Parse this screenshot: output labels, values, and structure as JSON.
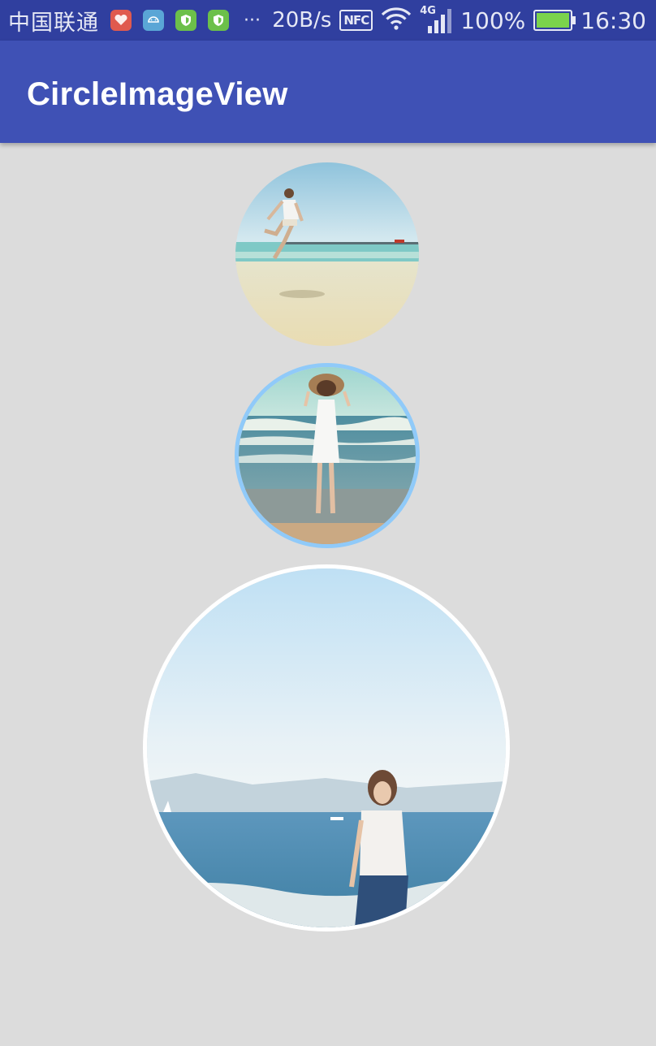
{
  "status_bar": {
    "carrier": "中国联通",
    "more_indicator": "···",
    "net_speed": "20B/s",
    "nfc_label": "NFC",
    "network_type": "4G",
    "battery_percent": "100%",
    "time": "16:30",
    "icons": [
      "health-app-icon",
      "android-app-icon",
      "shield-app-icon",
      "shield-app-icon-2",
      "wifi-icon",
      "signal-icon",
      "battery-icon"
    ]
  },
  "app_bar": {
    "title": "CircleImageView",
    "color": "#3f51b5"
  },
  "images": [
    {
      "name": "circle-image-jumping-man",
      "subject": "man jumping on beach",
      "border_color": null
    },
    {
      "name": "circle-image-woman-hat",
      "subject": "woman in white dress and straw hat facing the sea",
      "border_color": "#90caf9"
    },
    {
      "name": "circle-image-woman-sea",
      "subject": "woman standing by the sea",
      "border_color": "#ffffff"
    }
  ],
  "colors": {
    "status_bar": "#303f9f",
    "background": "#dcdcdc"
  }
}
